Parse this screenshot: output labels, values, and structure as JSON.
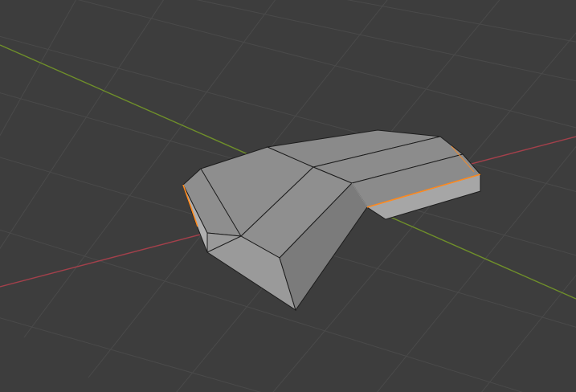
{
  "viewport": {
    "kind": "3d-viewport",
    "background_color": "#3d3d3d",
    "grid_color": "#4a4a4a",
    "x_axis_color": "#a3404b",
    "y_axis_color": "#6f8f2a"
  },
  "object": {
    "kind": "mesh",
    "mode": "edit-mode",
    "selected_edge_color": "#ff8a1e",
    "face_colors": {
      "top_left": "#8e8e8e",
      "top_mid": "#8b8b8b",
      "top_right": "#8a8a8a",
      "front_left": "#9a9a9a",
      "front_mid": "#7a7a7a",
      "front_right": "#a5a5a5",
      "right_end": "#b3b3b3"
    }
  }
}
